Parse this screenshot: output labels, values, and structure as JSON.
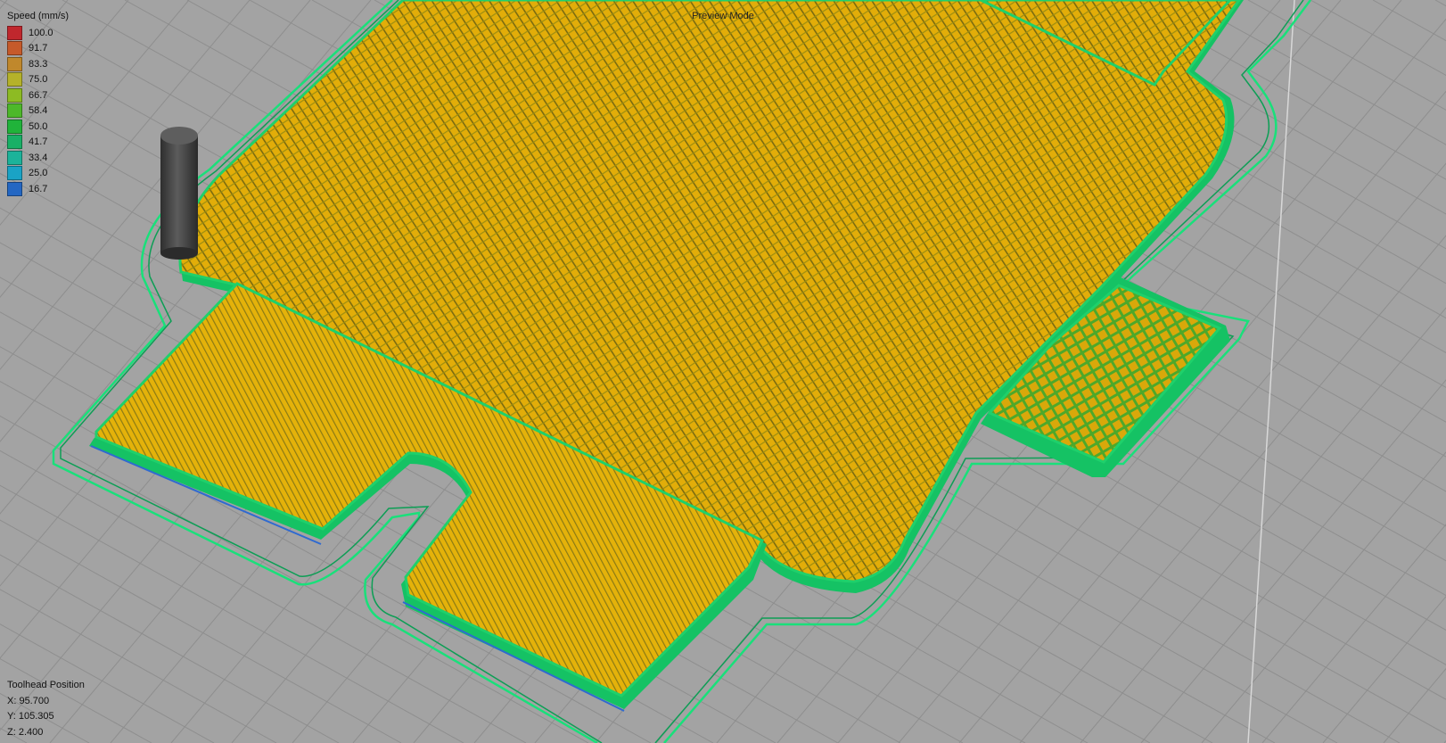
{
  "preview": {
    "mode_label": "Preview Mode"
  },
  "legend": {
    "title": "Speed (mm/s)",
    "items": [
      {
        "value": "100.0",
        "color": "#c0272d"
      },
      {
        "value": "91.7",
        "color": "#c65a2a"
      },
      {
        "value": "83.3",
        "color": "#c0882c"
      },
      {
        "value": "75.0",
        "color": "#b5b22a"
      },
      {
        "value": "66.7",
        "color": "#8dbb23"
      },
      {
        "value": "58.4",
        "color": "#4db82a"
      },
      {
        "value": "50.0",
        "color": "#20b33a"
      },
      {
        "value": "41.7",
        "color": "#19b066"
      },
      {
        "value": "33.4",
        "color": "#1cb39a"
      },
      {
        "value": "25.0",
        "color": "#1aa3c5"
      },
      {
        "value": "16.7",
        "color": "#2467c3"
      }
    ]
  },
  "toolhead": {
    "title": "Toolhead Position",
    "x": "X: 95.700",
    "y": "Y: 105.305",
    "z": "Z: 2.400"
  },
  "colors": {
    "bed": "#a3a3a3",
    "grid": "#8c8c8c",
    "infill": "#e2ad09",
    "perimeter": "#15c264",
    "skirt": "#19e07a",
    "bottom_edge": "#2f6ad0",
    "toolhead": "#4a4a4a"
  }
}
